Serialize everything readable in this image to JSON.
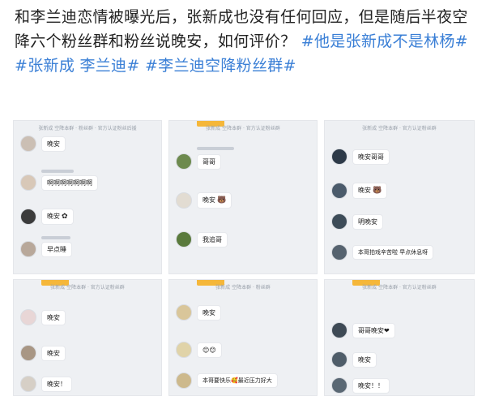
{
  "headline": {
    "text": "和李兰迪恋情被曝光后，张新成也没有任何回应，但是随后半夜空降六个粉丝群和粉丝说晚安，如何评价？",
    "hashtags": [
      "#他是张新成不是林杨#",
      "#张新成 李兰迪#",
      "#李兰迪空降粉丝群#"
    ]
  },
  "panels": [
    {
      "header": "张新成 空降本群 · 粉丝群 · 官方认证粉丝后援",
      "messages": [
        {
          "text": "晚安"
        },
        {
          "text": "啊啊啊啊啊啊啊"
        },
        {
          "text": "晚安"
        },
        {
          "text": "早点睡"
        }
      ]
    },
    {
      "header": "张新成 空降本群 · 官方认证粉丝群",
      "messages": [
        {
          "text": "哥哥"
        },
        {
          "text": "晚安"
        },
        {
          "text": "我追哥"
        }
      ]
    },
    {
      "header": "张新成 空降本群 · 官方认证粉丝群",
      "messages": [
        {
          "text": "晚安哥哥"
        },
        {
          "text": "晚安"
        },
        {
          "text": "明晚安"
        },
        {
          "text": "本哥拍戏辛苦啦 早点休息呀"
        }
      ]
    },
    {
      "header": "张新成 空降本群 · 官方认证粉丝群",
      "messages": [
        {
          "text": "晚安"
        },
        {
          "text": "晚安"
        },
        {
          "text": "晚安！"
        }
      ]
    },
    {
      "header": "张新成 空降本群 · 粉丝群",
      "messages": [
        {
          "text": "晚安"
        },
        {
          "text": "😊😊"
        },
        {
          "text": "本哥要快乐🥰最近压力好大"
        }
      ]
    },
    {
      "header": "张新成 空降本群 · 官方认证粉丝群",
      "messages": [
        {
          "text": "哥哥晚安❤"
        },
        {
          "text": "晚安"
        },
        {
          "text": "晚安！！"
        }
      ]
    }
  ],
  "sticker_icon": "bear-sticker-icon",
  "colors": {
    "hashtag": "#3a7fd6",
    "text": "#222222",
    "panel_bg": "#eef0f3",
    "accent_bar": "#f5b73a"
  }
}
